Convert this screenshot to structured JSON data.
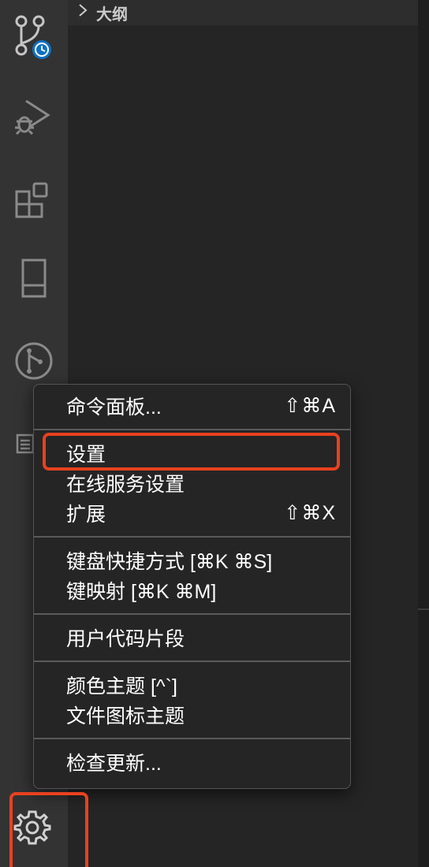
{
  "sidebar": {
    "section_title": "大纲"
  },
  "activity_bar": {
    "icons": [
      "source-control-timeline-icon",
      "run-debug-icon",
      "extensions-icon",
      "remote-explorer-icon",
      "git-graph-icon",
      "list-icon",
      "manage-gear-icon"
    ]
  },
  "menu": {
    "groups": [
      [
        {
          "label": "命令面板...",
          "shortcut": "⇧⌘A"
        }
      ],
      [
        {
          "label": "设置",
          "shortcut": ""
        },
        {
          "label": "在线服务设置",
          "shortcut": ""
        },
        {
          "label": "扩展",
          "shortcut": "⇧⌘X"
        }
      ],
      [
        {
          "label": "键盘快捷方式 [⌘K ⌘S]",
          "shortcut": ""
        },
        {
          "label": "键映射 [⌘K ⌘M]",
          "shortcut": ""
        }
      ],
      [
        {
          "label": "用户代码片段",
          "shortcut": ""
        }
      ],
      [
        {
          "label": "颜色主题 [^`]",
          "shortcut": ""
        },
        {
          "label": "文件图标主题",
          "shortcut": ""
        }
      ],
      [
        {
          "label": "检查更新...",
          "shortcut": ""
        }
      ]
    ]
  },
  "colors": {
    "highlight": "#e8411f",
    "badge": "#0e70c0"
  }
}
